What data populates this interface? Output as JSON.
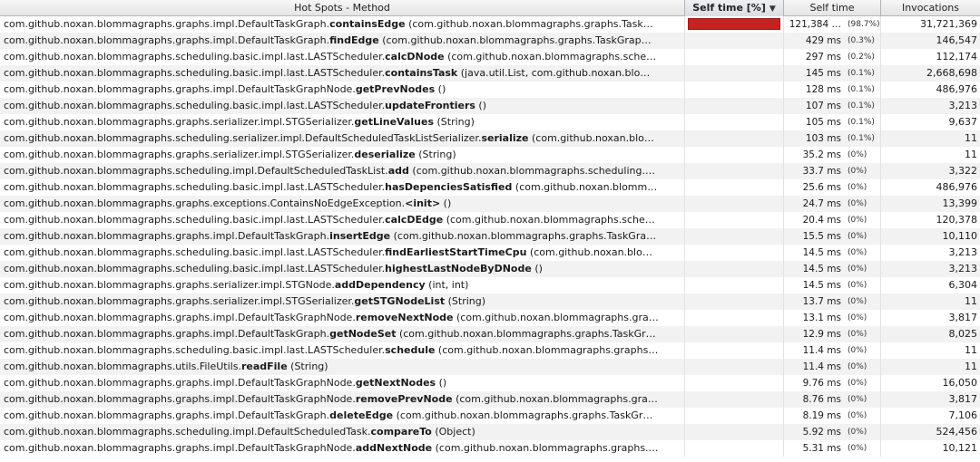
{
  "columns": {
    "method": "Hot Spots - Method",
    "self_time_pct": "Self time [%]",
    "self_time": "Self time",
    "invocations": "Invocations",
    "sort_icon": "triangle-down"
  },
  "bar_color": "#c62222",
  "rows": [
    {
      "prefix": "com.github.noxan.blommagraphs.graphs.impl.DefaultTaskGraph.",
      "method": "containsEdge",
      "args": " (com.github.noxan.blommagraphs.graphs.Task…",
      "time": "121,384 …",
      "pct": "(98.7%)",
      "bar": 0.987,
      "inv": "31,721,369"
    },
    {
      "prefix": "com.github.noxan.blommagraphs.graphs.impl.DefaultTaskGraph.",
      "method": "findEdge",
      "args": " (com.github.noxan.blommagraphs.graphs.TaskGrap…",
      "time": "429 ms",
      "pct": "(0.3%)",
      "bar": 0.003,
      "inv": "146,547"
    },
    {
      "prefix": "com.github.noxan.blommagraphs.scheduling.basic.impl.last.LASTScheduler.",
      "method": "calcDNode",
      "args": " (com.github.noxan.blommagraphs.sche…",
      "time": "297 ms",
      "pct": "(0.2%)",
      "bar": 0.002,
      "inv": "112,174"
    },
    {
      "prefix": "com.github.noxan.blommagraphs.scheduling.basic.impl.last.LASTScheduler.",
      "method": "containsTask",
      "args": " (java.util.List, com.github.noxan.blo…",
      "time": "145 ms",
      "pct": "(0.1%)",
      "bar": 0.001,
      "inv": "2,668,698"
    },
    {
      "prefix": "com.github.noxan.blommagraphs.graphs.impl.DefaultTaskGraphNode.",
      "method": "getPrevNodes",
      "args": " ()",
      "time": "128 ms",
      "pct": "(0.1%)",
      "bar": 0.001,
      "inv": "486,976"
    },
    {
      "prefix": "com.github.noxan.blommagraphs.scheduling.basic.impl.last.LASTScheduler.",
      "method": "updateFrontiers",
      "args": " ()",
      "time": "107 ms",
      "pct": "(0.1%)",
      "bar": 0.001,
      "inv": "3,213"
    },
    {
      "prefix": "com.github.noxan.blommagraphs.graphs.serializer.impl.STGSerializer.",
      "method": "getLineValues",
      "args": " (String)",
      "time": "105 ms",
      "pct": "(0.1%)",
      "bar": 0.001,
      "inv": "9,637"
    },
    {
      "prefix": "com.github.noxan.blommagraphs.scheduling.serializer.impl.DefaultScheduledTaskListSerializer.",
      "method": "serialize",
      "args": " (com.github.noxan.blo…",
      "time": "103 ms",
      "pct": "(0.1%)",
      "bar": 0.001,
      "inv": "11"
    },
    {
      "prefix": "com.github.noxan.blommagraphs.graphs.serializer.impl.STGSerializer.",
      "method": "deserialize",
      "args": " (String)",
      "time": "35.2 ms",
      "pct": "(0%)",
      "bar": 0,
      "inv": "11"
    },
    {
      "prefix": "com.github.noxan.blommagraphs.scheduling.impl.DefaultScheduledTaskList.",
      "method": "add",
      "args": " (com.github.noxan.blommagraphs.scheduling.…",
      "time": "33.7 ms",
      "pct": "(0%)",
      "bar": 0,
      "inv": "3,322"
    },
    {
      "prefix": "com.github.noxan.blommagraphs.scheduling.basic.impl.last.LASTScheduler.",
      "method": "hasDepenciesSatisfied",
      "args": " (com.github.noxan.blomm…",
      "time": "25.6 ms",
      "pct": "(0%)",
      "bar": 0,
      "inv": "486,976"
    },
    {
      "prefix": "com.github.noxan.blommagraphs.graphs.exceptions.ContainsNoEdgeException.",
      "method": "<init>",
      "args": " ()",
      "time": "24.7 ms",
      "pct": "(0%)",
      "bar": 0,
      "inv": "13,399"
    },
    {
      "prefix": "com.github.noxan.blommagraphs.scheduling.basic.impl.last.LASTScheduler.",
      "method": "calcDEdge",
      "args": " (com.github.noxan.blommagraphs.sche…",
      "time": "20.4 ms",
      "pct": "(0%)",
      "bar": 0,
      "inv": "120,378"
    },
    {
      "prefix": "com.github.noxan.blommagraphs.graphs.impl.DefaultTaskGraph.",
      "method": "insertEdge",
      "args": " (com.github.noxan.blommagraphs.graphs.TaskGra…",
      "time": "15.5 ms",
      "pct": "(0%)",
      "bar": 0,
      "inv": "10,110"
    },
    {
      "prefix": "com.github.noxan.blommagraphs.scheduling.basic.impl.last.LASTScheduler.",
      "method": "findEarliestStartTimeCpu",
      "args": " (com.github.noxan.blo…",
      "time": "14.5 ms",
      "pct": "(0%)",
      "bar": 0,
      "inv": "3,213"
    },
    {
      "prefix": "com.github.noxan.blommagraphs.scheduling.basic.impl.last.LASTScheduler.",
      "method": "highestLastNodeByDNode",
      "args": " ()",
      "time": "14.5 ms",
      "pct": "(0%)",
      "bar": 0,
      "inv": "3,213"
    },
    {
      "prefix": "com.github.noxan.blommagraphs.graphs.serializer.impl.STGNode.",
      "method": "addDependency",
      "args": " (int, int)",
      "time": "14.5 ms",
      "pct": "(0%)",
      "bar": 0,
      "inv": "6,304"
    },
    {
      "prefix": "com.github.noxan.blommagraphs.graphs.serializer.impl.STGSerializer.",
      "method": "getSTGNodeList",
      "args": " (String)",
      "time": "13.7 ms",
      "pct": "(0%)",
      "bar": 0,
      "inv": "11"
    },
    {
      "prefix": "com.github.noxan.blommagraphs.graphs.impl.DefaultTaskGraphNode.",
      "method": "removeNextNode",
      "args": " (com.github.noxan.blommagraphs.gra…",
      "time": "13.1 ms",
      "pct": "(0%)",
      "bar": 0,
      "inv": "3,817"
    },
    {
      "prefix": "com.github.noxan.blommagraphs.graphs.impl.DefaultTaskGraph.",
      "method": "getNodeSet",
      "args": " (com.github.noxan.blommagraphs.graphs.TaskGr…",
      "time": "12.9 ms",
      "pct": "(0%)",
      "bar": 0,
      "inv": "8,025"
    },
    {
      "prefix": "com.github.noxan.blommagraphs.scheduling.basic.impl.last.LASTScheduler.",
      "method": "schedule",
      "args": " (com.github.noxan.blommagraphs.graphs…",
      "time": "11.4 ms",
      "pct": "(0%)",
      "bar": 0,
      "inv": "11"
    },
    {
      "prefix": "com.github.noxan.blommagraphs.utils.FileUtils.",
      "method": "readFile",
      "args": " (String)",
      "time": "11.4 ms",
      "pct": "(0%)",
      "bar": 0,
      "inv": "11"
    },
    {
      "prefix": "com.github.noxan.blommagraphs.graphs.impl.DefaultTaskGraphNode.",
      "method": "getNextNodes",
      "args": " ()",
      "time": "9.76 ms",
      "pct": "(0%)",
      "bar": 0,
      "inv": "16,050"
    },
    {
      "prefix": "com.github.noxan.blommagraphs.graphs.impl.DefaultTaskGraphNode.",
      "method": "removePrevNode",
      "args": " (com.github.noxan.blommagraphs.gra…",
      "time": "8.76 ms",
      "pct": "(0%)",
      "bar": 0,
      "inv": "3,817"
    },
    {
      "prefix": "com.github.noxan.blommagraphs.graphs.impl.DefaultTaskGraph.",
      "method": "deleteEdge",
      "args": " (com.github.noxan.blommagraphs.graphs.TaskGr…",
      "time": "8.19 ms",
      "pct": "(0%)",
      "bar": 0,
      "inv": "7,106"
    },
    {
      "prefix": "com.github.noxan.blommagraphs.scheduling.impl.DefaultScheduledTask.",
      "method": "compareTo",
      "args": " (Object)",
      "time": "5.92 ms",
      "pct": "(0%)",
      "bar": 0,
      "inv": "524,456"
    },
    {
      "prefix": "com.github.noxan.blommagraphs.graphs.impl.DefaultTaskGraphNode.",
      "method": "addNextNode",
      "args": " (com.github.noxan.blommagraphs.graphs.…",
      "time": "5.31 ms",
      "pct": "(0%)",
      "bar": 0,
      "inv": "10,121"
    }
  ]
}
